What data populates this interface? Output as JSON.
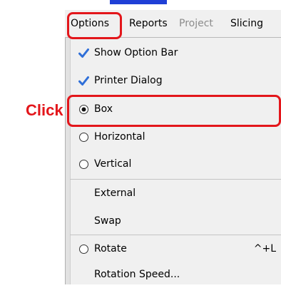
{
  "menubar": {
    "items": [
      {
        "label": "Options",
        "enabled": true
      },
      {
        "label": "Reports",
        "enabled": true
      },
      {
        "label": "Project",
        "enabled": false
      },
      {
        "label": "Slicing",
        "enabled": true
      }
    ]
  },
  "menu": {
    "items": [
      {
        "label": "Show Option Bar",
        "type": "checkbox",
        "checked": true,
        "icon": "checkmark-icon"
      },
      {
        "label": "Printer Dialog",
        "type": "checkbox",
        "checked": true,
        "icon": "checkmark-icon"
      },
      {
        "label": "Box",
        "type": "radio",
        "selected": true,
        "icon": "radio-selected-icon"
      },
      {
        "label": "Horizontal",
        "type": "radio",
        "selected": false,
        "icon": "radio-empty-icon"
      },
      {
        "label": "Vertical",
        "type": "radio",
        "selected": false,
        "icon": "radio-empty-icon"
      },
      {
        "label": "External",
        "type": "action"
      },
      {
        "label": "Swap",
        "type": "action"
      },
      {
        "label": "Rotate",
        "type": "radio",
        "selected": false,
        "icon": "radio-empty-icon",
        "accelerator": "^+L"
      },
      {
        "label": "Rotation Speed...",
        "type": "action"
      }
    ]
  },
  "annotation": {
    "label": "Click",
    "color": "#e3161b"
  },
  "colors": {
    "checkmark": "#2f6fd8",
    "highlight": "#e3161b",
    "menu_background": "#f0f0f0",
    "disabled_text": "#8c8c8c"
  }
}
